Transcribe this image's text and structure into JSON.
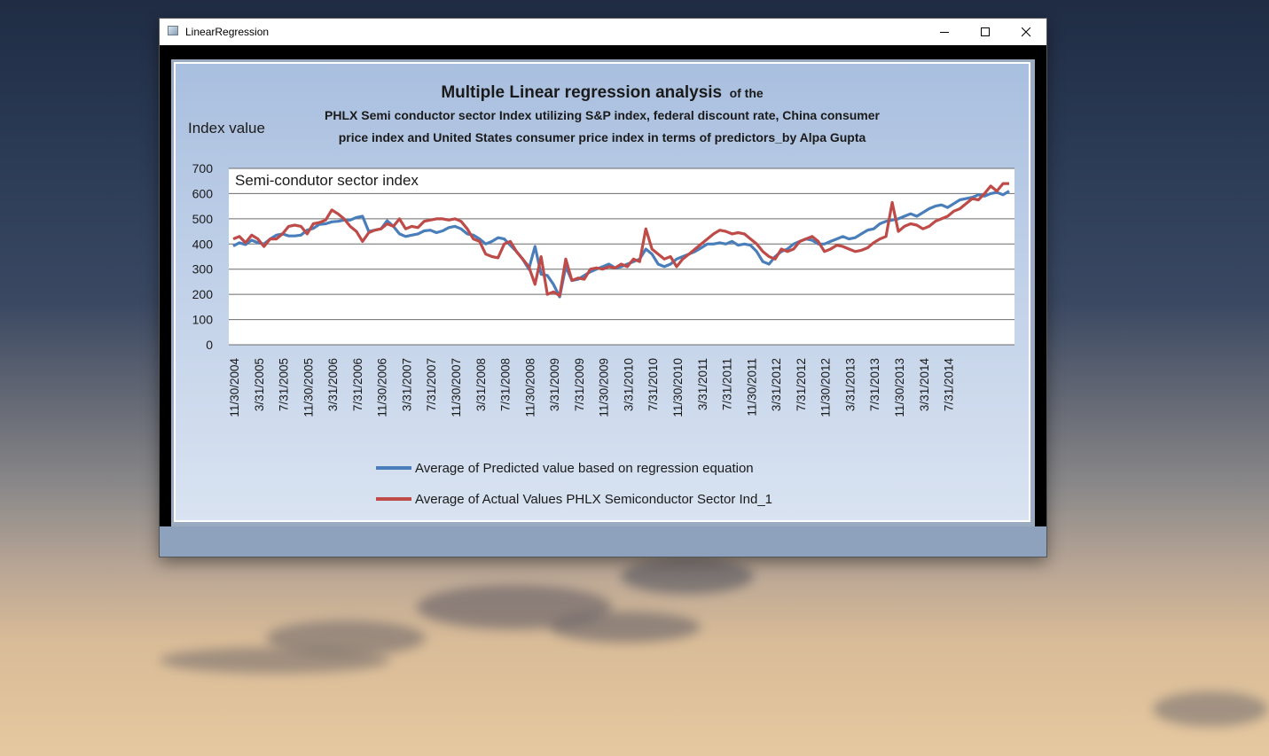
{
  "window": {
    "title": "LinearRegression"
  },
  "chart_data": {
    "type": "line",
    "title_bold": "Multiple Linear regression analysis",
    "title_suffix": "of the",
    "subtitle_line1": "PHLX Semi conductor sector Index utilizing S&P index, federal discount rate, China consumer",
    "subtitle_line2": "price index and United States consumer price index in terms of predictors_by Alpa Gupta",
    "ylabel": "Index value",
    "plot_label": "Semi-condutor sector index",
    "ylim": [
      0,
      700
    ],
    "yticks": [
      "700",
      "600",
      "500",
      "400",
      "300",
      "200",
      "100",
      "0"
    ],
    "grid": true,
    "legend_position": "bottom",
    "xticklabels": [
      "11/30/2004",
      "3/31/2005",
      "7/31/2005",
      "11/30/2005",
      "3/31/2006",
      "7/31/2006",
      "11/30/2006",
      "3/31/2007",
      "7/31/2007",
      "11/30/2007",
      "3/31/2008",
      "7/31/2008",
      "11/30/2008",
      "3/31/2009",
      "7/31/2009",
      "11/30/2009",
      "3/31/2010",
      "7/31/2010",
      "11/30/2010",
      "3/31/2011",
      "7/31/2011",
      "11/30/2011",
      "3/31/2012",
      "7/31/2012",
      "11/30/2012",
      "3/31/2013",
      "7/31/2013",
      "11/30/2013",
      "3/31/2014",
      "7/31/2014"
    ],
    "x_start": "11/30/2004",
    "x_step": "1 month",
    "series": [
      {
        "name": "Average of Predicted value  based on regression equation",
        "color": "#4a7ebb",
        "values": [
          392,
          405,
          398,
          415,
          405,
          400,
          420,
          435,
          440,
          432,
          432,
          435,
          455,
          462,
          478,
          480,
          488,
          490,
          495,
          495,
          505,
          510,
          450,
          455,
          460,
          492,
          470,
          440,
          430,
          435,
          440,
          452,
          455,
          445,
          452,
          465,
          470,
          460,
          440,
          435,
          420,
          400,
          410,
          425,
          420,
          395,
          370,
          340,
          300,
          390,
          280,
          275,
          240,
          190,
          310,
          255,
          260,
          275,
          290,
          300,
          310,
          320,
          305,
          310,
          320,
          330,
          340,
          380,
          360,
          320,
          310,
          320,
          340,
          350,
          360,
          370,
          385,
          400,
          400,
          405,
          400,
          410,
          395,
          400,
          395,
          370,
          330,
          320,
          350,
          370,
          380,
          400,
          410,
          420,
          415,
          400,
          400,
          410,
          420,
          430,
          420,
          425,
          440,
          455,
          460,
          480,
          490,
          495,
          500,
          510,
          520,
          510,
          525,
          540,
          550,
          555,
          545,
          560,
          575,
          580,
          585,
          595,
          590,
          600,
          605,
          595,
          610
        ]
      },
      {
        "name": "Average of Actual Values PHLX Semiconductor Sector Ind_1",
        "color": "#be4b48",
        "values": [
          420,
          430,
          405,
          435,
          420,
          390,
          420,
          420,
          440,
          470,
          475,
          470,
          440,
          480,
          485,
          495,
          535,
          520,
          500,
          470,
          450,
          410,
          445,
          455,
          460,
          480,
          470,
          500,
          460,
          470,
          465,
          490,
          495,
          500,
          500,
          495,
          500,
          490,
          460,
          420,
          410,
          360,
          350,
          345,
          400,
          410,
          370,
          340,
          310,
          240,
          350,
          200,
          210,
          195,
          340,
          255,
          265,
          260,
          300,
          305,
          300,
          310,
          305,
          320,
          310,
          340,
          330,
          460,
          380,
          360,
          340,
          350,
          310,
          340,
          360,
          380,
          400,
          420,
          440,
          455,
          450,
          440,
          445,
          440,
          420,
          400,
          370,
          350,
          340,
          380,
          370,
          380,
          410,
          420,
          430,
          410,
          370,
          380,
          395,
          390,
          380,
          370,
          375,
          385,
          405,
          420,
          430,
          565,
          450,
          470,
          480,
          475,
          460,
          470,
          490,
          500,
          510,
          530,
          540,
          560,
          580,
          575,
          600,
          630,
          610,
          640,
          640
        ]
      }
    ]
  }
}
